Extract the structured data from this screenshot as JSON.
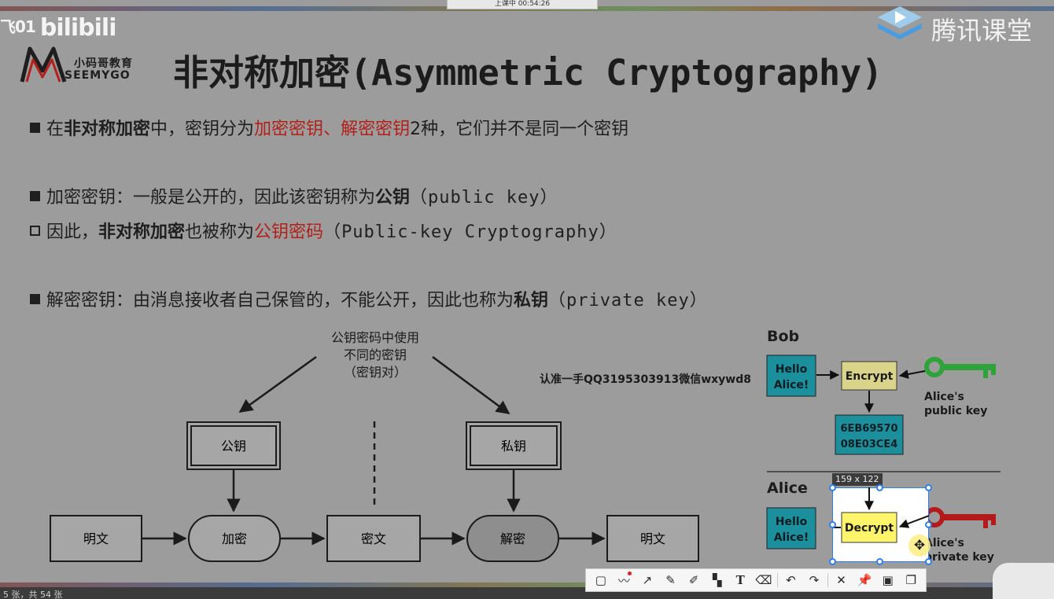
{
  "watermarks": {
    "bilibili_prefix": "飞01",
    "bilibili_brand": "bilibili",
    "tencent_brand": "腾讯课堂"
  },
  "recording_widget": {
    "text": "上课中 00:54:26"
  },
  "logo": {
    "name_cn": "小码哥教育",
    "name_en": "SEEMYGO"
  },
  "slide": {
    "title_cn": "非对称加密",
    "title_en": "(Asymmetric Cryptography)",
    "lines": [
      {
        "segments": [
          "在",
          "非对称加密",
          "中，密钥分为",
          "加密密钥",
          "、",
          "解密密钥",
          "2种，它们并不是同一个密钥"
        ]
      },
      {
        "segments": [
          "加密密钥：一般是公开的，因此该密钥称为",
          "公钥",
          "（public key）"
        ]
      },
      {
        "segments": [
          "因此，",
          "非对称加密",
          "也被称为",
          "公钥密码",
          "（Public-key Cryptography）"
        ]
      },
      {
        "segments": [
          "解密密钥：由消息接收者自己保管的，不能公开，因此也称为",
          "私钥",
          "（private key）"
        ]
      }
    ]
  },
  "diagram": {
    "note_line1": "公钥密码中使用",
    "note_line2": "不同的密钥",
    "note_line3": "（密钥对）",
    "public_key": "公钥",
    "private_key": "私钥",
    "plaintext_in": "明文",
    "encrypt": "加密",
    "ciphertext": "密文",
    "decrypt": "解密",
    "plaintext_out": "明文"
  },
  "bob_alice": {
    "bob_label": "Bob",
    "alice_label": "Alice",
    "hello_1": "Hello",
    "hello_2": "Alice!",
    "encrypt": "Encrypt",
    "decrypt": "Decrypt",
    "cipher_1": "6EB69570",
    "cipher_2": "08E03CE4",
    "pub_key_1": "Alice's",
    "pub_key_2": "public key",
    "priv_key_1": "Alice's",
    "priv_key_2": "private key",
    "ad_text": "认准一手QQ3195303913微信wxywd8"
  },
  "screenshot_tool": {
    "size_label": "159 x 122"
  },
  "status": {
    "page_text": "5 张，共 54 张"
  },
  "colors": {
    "accent_red": "#b3201a",
    "teal_box": "#1b8f9c",
    "encrypt_box": "#d9d48a",
    "decrypt_box": "#fff56a",
    "key_green": "#2ea33a",
    "key_red": "#b41a1a",
    "selection_blue": "#2d7ff0"
  },
  "icons": [
    "rect-tool-icon",
    "pen-curve-icon",
    "arrow-tool-icon",
    "pencil-icon",
    "marker-icon",
    "mosaic-icon",
    "text-tool-icon",
    "eraser-icon",
    "undo-icon",
    "redo-icon",
    "close-icon",
    "pin-icon",
    "save-icon",
    "copy-icon"
  ]
}
